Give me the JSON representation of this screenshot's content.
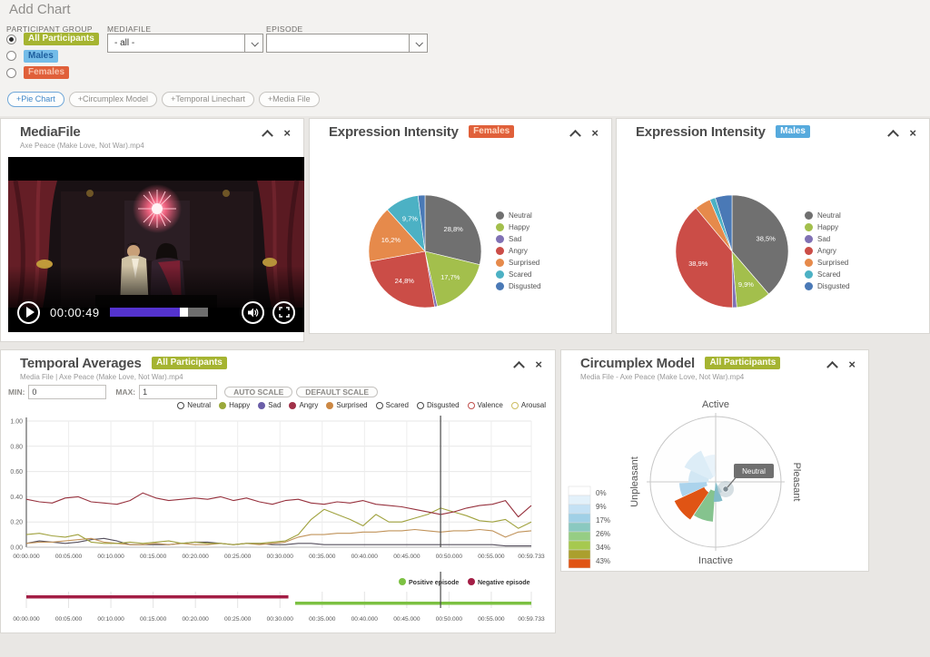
{
  "page": {
    "title": "Add Chart"
  },
  "controls": {
    "participant_group_label": "PARTICIPANT GROUP",
    "options": [
      {
        "label": "All Participants",
        "selected": true,
        "bg": "#a5b431",
        "fg": "#fbfcee"
      },
      {
        "label": "Males",
        "selected": false,
        "bg": "#74bce8",
        "fg": "#1d5e9e"
      },
      {
        "label": "Females",
        "selected": false,
        "bg": "#e0603a",
        "fg": "#f8c2ac"
      }
    ],
    "mediafile_label": "MEDIAFILE",
    "mediafile_value": "- all -",
    "episode_label": "EPISODE",
    "episode_value": "",
    "add_buttons": [
      {
        "label": "+Pie Chart",
        "primary": true
      },
      {
        "label": "+Circumplex Model",
        "primary": false
      },
      {
        "label": "+Temporal Linechart",
        "primary": false
      },
      {
        "label": "+Media File",
        "primary": false
      }
    ]
  },
  "icons": {
    "collapse": "chevron-up-icon",
    "close": "close-icon",
    "play": "play-icon",
    "volume": "speaker-icon",
    "fullscreen": "expand-icon"
  },
  "media_panel": {
    "title": "MediaFile",
    "subtitle": "Axe Peace (Make Love, Not War).mp4",
    "player": {
      "time": "00:00:49",
      "progress_pct": 72,
      "accent": "#5433cf"
    }
  },
  "chart_data": [
    {
      "id": "pie_females",
      "type": "pie",
      "title": "Expression Intensity",
      "badge": "Females",
      "badge_bg": "#e0603a",
      "badge_fg": "#ffd9c4",
      "legend_position": "right",
      "slices": [
        {
          "name": "Neutral",
          "value": 28.8,
          "label": "28,8%",
          "color": "#707070"
        },
        {
          "name": "Happy",
          "value": 17.7,
          "label": "17,7%",
          "color": "#a3bf4c"
        },
        {
          "name": "Sad",
          "value": 0.8,
          "label": null,
          "color": "#8071b4"
        },
        {
          "name": "Angry",
          "value": 24.8,
          "label": "24,8%",
          "color": "#cb4d47"
        },
        {
          "name": "Surprised",
          "value": 16.2,
          "label": "16,2%",
          "color": "#e68a4b"
        },
        {
          "name": "Scared",
          "value": 9.7,
          "label": "9,7%",
          "color": "#4cb1c4"
        },
        {
          "name": "Disgusted",
          "value": 2.0,
          "label": null,
          "color": "#4a79b6"
        }
      ]
    },
    {
      "id": "pie_males",
      "type": "pie",
      "title": "Expression Intensity",
      "badge": "Males",
      "badge_bg": "#56aadd",
      "badge_fg": "#ffffff",
      "legend_position": "right",
      "slices": [
        {
          "name": "Neutral",
          "value": 38.5,
          "label": "38,5%",
          "color": "#707070"
        },
        {
          "name": "Happy",
          "value": 9.9,
          "label": "9,9%",
          "color": "#a3bf4c"
        },
        {
          "name": "Sad",
          "value": 1.2,
          "label": null,
          "color": "#8071b4"
        },
        {
          "name": "Angry",
          "value": 38.9,
          "label": "38,9%",
          "color": "#cb4d47"
        },
        {
          "name": "Surprised",
          "value": 4.6,
          "label": null,
          "color": "#e68a4b"
        },
        {
          "name": "Scared",
          "value": 1.6,
          "label": null,
          "color": "#4cb1c4"
        },
        {
          "name": "Disgusted",
          "value": 4.8,
          "label": null,
          "color": "#4a79b6"
        }
      ]
    },
    {
      "id": "temporal",
      "type": "line",
      "title": "Temporal Averages",
      "badge": "All Participants",
      "badge_bg": "#a5b431",
      "badge_fg": "#fbfcee",
      "subtitle": "Media File | Axe Peace (Make Love, Not War).mp4",
      "toolbar": {
        "min_label": "MIN:",
        "min_value": "0",
        "max_label": "MAX:",
        "max_value": "1",
        "buttons": [
          "AUTO SCALE",
          "DEFAULT SCALE"
        ]
      },
      "ylim": [
        0,
        1
      ],
      "yticks": [
        "0.00",
        "0.20",
        "0.40",
        "0.60",
        "0.80",
        "1.00"
      ],
      "xticks": [
        "00:00.000",
        "00:05.000",
        "00:10.000",
        "00:15.000",
        "00:20.000",
        "00:25.000",
        "00:30.000",
        "00:35.000",
        "00:40.000",
        "00:45.000",
        "00:50.000",
        "00:55.000",
        "00:59.733"
      ],
      "xtick_seconds": [
        0,
        5,
        10,
        15,
        20,
        25,
        30,
        35,
        40,
        45,
        50,
        55,
        59.733
      ],
      "x_total_seconds": 59.733,
      "cursor_seconds": 49,
      "grid": true,
      "legend_position": "top-right",
      "legend": [
        {
          "name": "Neutral",
          "color": "#4a4a4a",
          "filled": false
        },
        {
          "name": "Happy",
          "color": "#9aa83a",
          "filled": true
        },
        {
          "name": "Sad",
          "color": "#6b5ea8",
          "filled": true
        },
        {
          "name": "Angry",
          "color": "#a03048",
          "filled": true
        },
        {
          "name": "Surprised",
          "color": "#cc8844",
          "filled": true
        },
        {
          "name": "Scared",
          "color": "#4a4a4a",
          "filled": false
        },
        {
          "name": "Disgusted",
          "color": "#4a4a4a",
          "filled": false
        },
        {
          "name": "Valence",
          "color": "#c0504d",
          "filled": false
        },
        {
          "name": "Arousal",
          "color": "#cdbd62",
          "filled": false
        }
      ],
      "series": [
        {
          "name": "Sad",
          "color": "#56505e",
          "values": [
            0.03,
            0.05,
            0.04,
            0.03,
            0.04,
            0.06,
            0.07,
            0.05,
            0.02,
            0.02,
            0.02,
            0.02,
            0.03,
            0.04,
            0.04,
            0.03,
            0.02,
            0.03,
            0.03,
            0.02,
            0.02,
            0.03,
            0.03,
            0.02,
            0.02,
            0.02,
            0.02,
            0.02,
            0.02,
            0.02,
            0.02,
            0.02,
            0.02,
            0.02,
            0.02,
            0.02,
            0.02,
            0.01,
            0.01,
            0.01
          ]
        },
        {
          "name": "Surprised",
          "color": "#c1935a",
          "values": [
            0.03,
            0.04,
            0.04,
            0.05,
            0.06,
            0.07,
            0.04,
            0.03,
            0.02,
            0.02,
            0.03,
            0.02,
            0.03,
            0.02,
            0.02,
            0.03,
            0.02,
            0.03,
            0.02,
            0.03,
            0.04,
            0.08,
            0.1,
            0.1,
            0.11,
            0.11,
            0.12,
            0.12,
            0.13,
            0.13,
            0.14,
            0.13,
            0.12,
            0.13,
            0.13,
            0.14,
            0.13,
            0.08,
            0.12,
            0.13
          ]
        },
        {
          "name": "Happy",
          "color": "#a0a23e",
          "values": [
            0.1,
            0.11,
            0.09,
            0.08,
            0.1,
            0.04,
            0.03,
            0.03,
            0.04,
            0.03,
            0.04,
            0.05,
            0.03,
            0.04,
            0.03,
            0.03,
            0.02,
            0.03,
            0.03,
            0.04,
            0.05,
            0.1,
            0.22,
            0.3,
            0.26,
            0.22,
            0.17,
            0.26,
            0.2,
            0.2,
            0.23,
            0.26,
            0.31,
            0.28,
            0.25,
            0.21,
            0.2,
            0.22,
            0.15,
            0.2
          ]
        },
        {
          "name": "Angry",
          "color": "#97323e",
          "values": [
            0.38,
            0.36,
            0.35,
            0.39,
            0.4,
            0.36,
            0.35,
            0.34,
            0.37,
            0.43,
            0.39,
            0.37,
            0.38,
            0.39,
            0.38,
            0.4,
            0.37,
            0.39,
            0.36,
            0.34,
            0.37,
            0.38,
            0.35,
            0.34,
            0.36,
            0.35,
            0.37,
            0.34,
            0.33,
            0.32,
            0.3,
            0.28,
            0.26,
            0.28,
            0.31,
            0.33,
            0.34,
            0.37,
            0.24,
            0.33
          ]
        }
      ]
    },
    {
      "id": "episodes",
      "type": "timeline",
      "legend": [
        {
          "name": "Positive episode",
          "color": "#7cc142"
        },
        {
          "name": "Negative episode",
          "color": "#a31e45"
        }
      ],
      "bars": [
        {
          "name": "Negative episode",
          "start": 0,
          "end": 31,
          "color": "#a31e45",
          "row": 0
        },
        {
          "name": "Positive episode",
          "start": 31.8,
          "end": 59.733,
          "color": "#7cc142",
          "row": 1
        }
      ],
      "xticks": [
        "00:00.000",
        "00:05.000",
        "00:10.000",
        "00:15.000",
        "00:20.000",
        "00:25.000",
        "00:30.000",
        "00:35.000",
        "00:40.000",
        "00:45.000",
        "00:50.000",
        "00:55.000",
        "00:59.733"
      ],
      "xtick_seconds": [
        0,
        5,
        10,
        15,
        20,
        25,
        30,
        35,
        40,
        45,
        50,
        55,
        59.733
      ],
      "x_total_seconds": 59.733,
      "cursor_seconds": 49
    },
    {
      "id": "circumplex",
      "type": "polar",
      "title": "Circumplex Model",
      "badge": "All Participants",
      "badge_bg": "#a5b431",
      "badge_fg": "#fbfcee",
      "subtitle": "Media File - Axe Peace (Make Love, Not War).mp4",
      "axis_labels": {
        "top": "Active",
        "right": "Pleasant",
        "bottom": "Inactive",
        "left": "Unpleasant"
      },
      "scale": {
        "colors": [
          "#ffffff",
          "#e3f1fa",
          "#c4e1f4",
          "#a0d0e6",
          "#8ac9c0",
          "#96cd84",
          "#a6c94f",
          "#ab9f2d",
          "#e05414"
        ],
        "labels": [
          "0%",
          "9%",
          "17%",
          "26%",
          "34%",
          "43%"
        ]
      },
      "wedges": [
        {
          "a0": 335,
          "a1": 358,
          "r0": 6,
          "r1": 30,
          "color": "#e9f3fa"
        },
        {
          "a0": 295,
          "a1": 335,
          "r0": 6,
          "r1": 38,
          "color": "#ddedf7"
        },
        {
          "a0": 268,
          "a1": 295,
          "r0": 8,
          "r1": 30,
          "color": "#d2e7f4"
        },
        {
          "a0": 246,
          "a1": 268,
          "r0": 10,
          "r1": 40,
          "color": "#abd3ec"
        },
        {
          "a0": 214,
          "a1": 245,
          "r0": 14,
          "r1": 50,
          "color": "#e05414"
        },
        {
          "a0": 184,
          "a1": 213,
          "r0": 10,
          "r1": 44,
          "color": "#85c38e"
        },
        {
          "a0": 160,
          "a1": 186,
          "r0": 0,
          "r1": 22,
          "color": "#82bcc9"
        },
        {
          "a0": 148,
          "a1": 161,
          "r0": 0,
          "r1": 13,
          "color": "#bcd9e2"
        }
      ],
      "point": {
        "angle": 126,
        "radius": 13.6,
        "tooltip": "Neutral"
      }
    }
  ]
}
